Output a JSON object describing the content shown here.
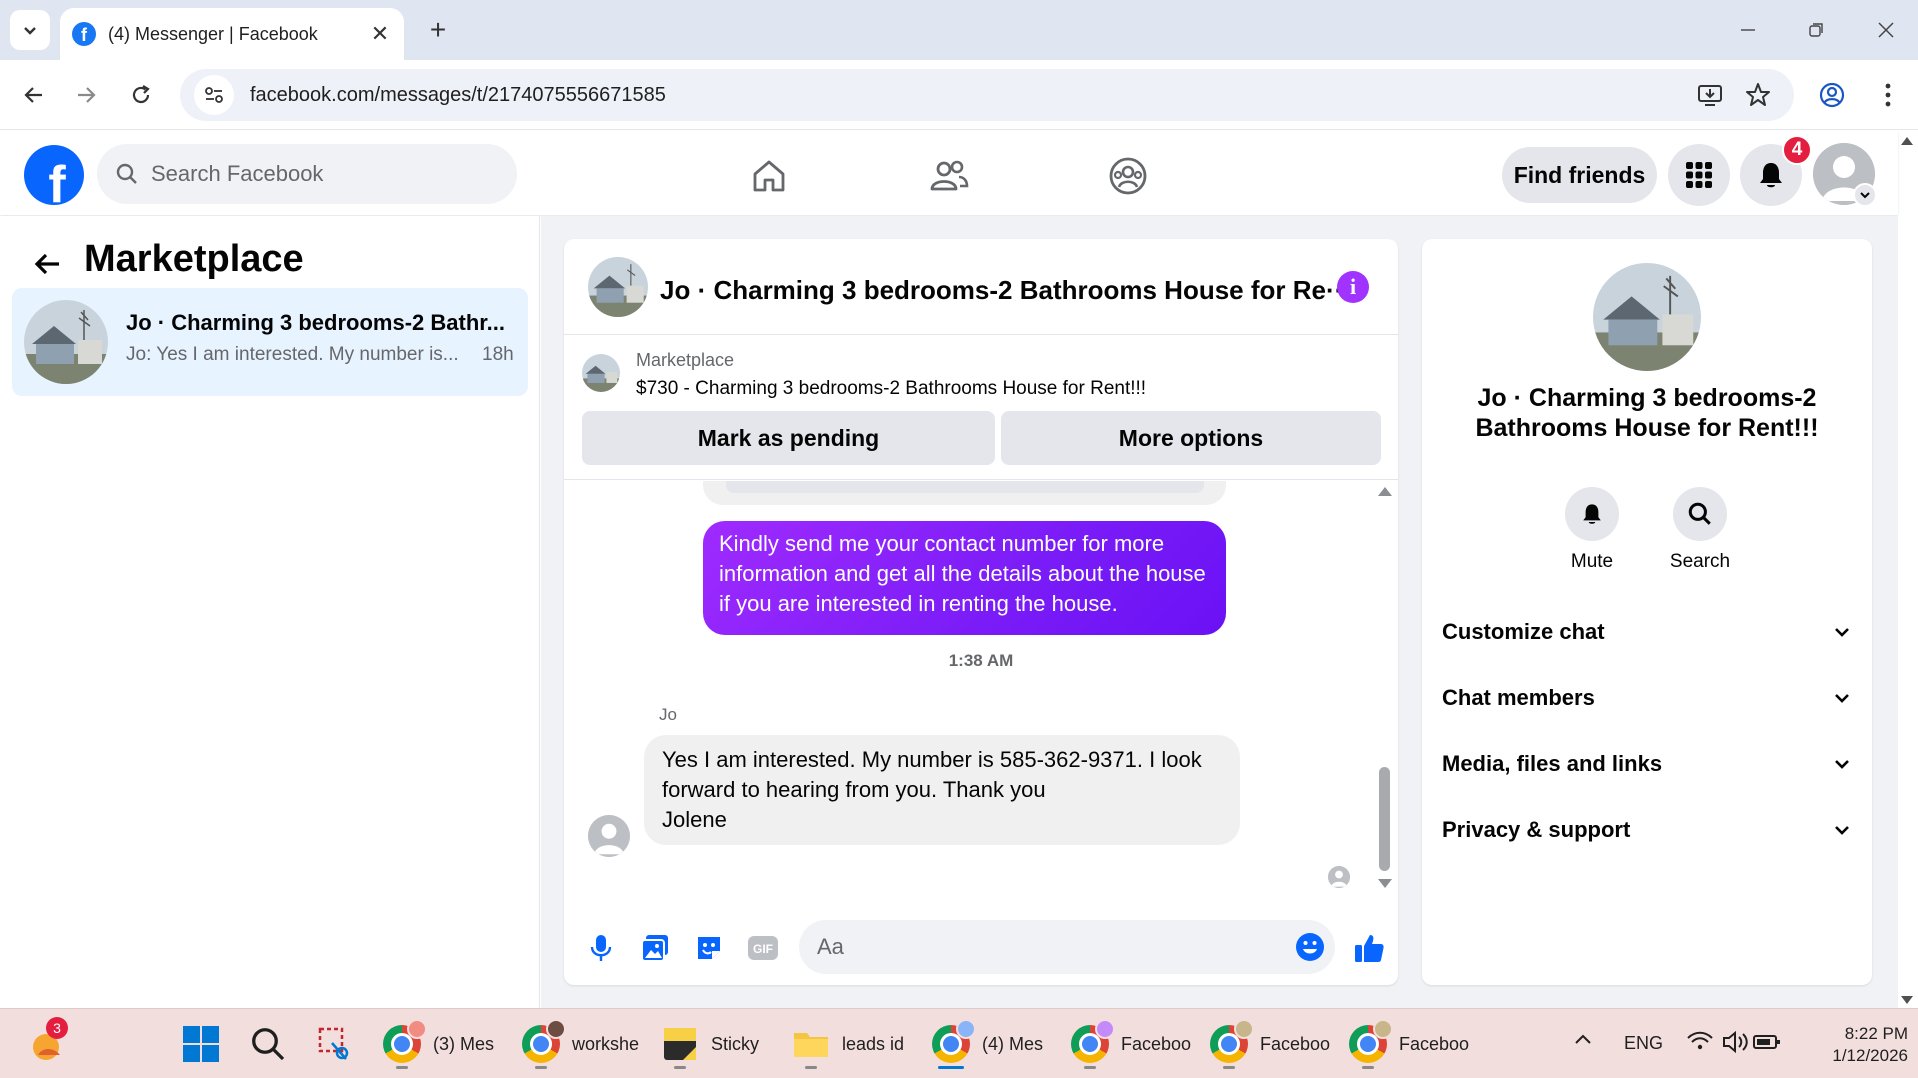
{
  "browser": {
    "tab_title": "(4) Messenger | Facebook",
    "url": "facebook.com/messages/t/2174075556671585"
  },
  "fb_header": {
    "search_placeholder": "Search Facebook",
    "find_friends_label": "Find friends",
    "notification_count": "4"
  },
  "left_panel": {
    "title": "Marketplace",
    "conversation": {
      "name": "Jo · Charming 3 bedrooms-2 Bathr...",
      "preview": "Jo: Yes I am interested. My number is...",
      "time": "18h"
    }
  },
  "chat": {
    "header_title": "Jo · Charming 3 bedrooms-2 Bathrooms House for Re···",
    "listing_label": "Marketplace",
    "listing_text": "$730 - Charming 3 bedrooms-2 Bathrooms House for Rent!!!",
    "mark_pending_label": "Mark as pending",
    "more_options_label": "More options",
    "outgoing_message": "Kindly send me your contact number for more information and get all the details about the house if you are interested in renting the house.",
    "timestamp": "1:38 AM",
    "sender_name": "Jo",
    "incoming_lines": [
      "Yes I am interested. My number is 585-362-9371. I look",
      "forward to hearing from you. Thank you",
      "Jolene"
    ],
    "composer_placeholder": "Aa"
  },
  "right_panel": {
    "name": "Jo · Charming 3 bedrooms-2 Bathrooms House for Rent!!!",
    "mute_label": "Mute",
    "search_label": "Search",
    "sections": [
      "Customize chat",
      "Chat members",
      "Media, files and links",
      "Privacy & support"
    ]
  },
  "taskbar": {
    "apps": [
      {
        "label": "(3) Mes",
        "icon": "chrome-icon"
      },
      {
        "label": "workshe",
        "icon": "chrome-icon"
      },
      {
        "label": "Sticky",
        "icon": "sticky-notes-icon"
      },
      {
        "label": "leads id",
        "icon": "folder-icon"
      },
      {
        "label": "(4) Mes",
        "icon": "chrome-icon"
      },
      {
        "label": "Faceboo",
        "icon": "chrome-icon"
      },
      {
        "label": "Faceboo",
        "icon": "chrome-icon"
      },
      {
        "label": "Faceboo",
        "icon": "chrome-icon"
      }
    ],
    "widget_badge": "3",
    "language": "ENG",
    "time": "8:22 PM",
    "date": "1/12/2026"
  },
  "colors": {
    "fb_blue": "#0866ff",
    "messenger_purple": "#a033ff",
    "notification_red": "#e41e3f"
  }
}
